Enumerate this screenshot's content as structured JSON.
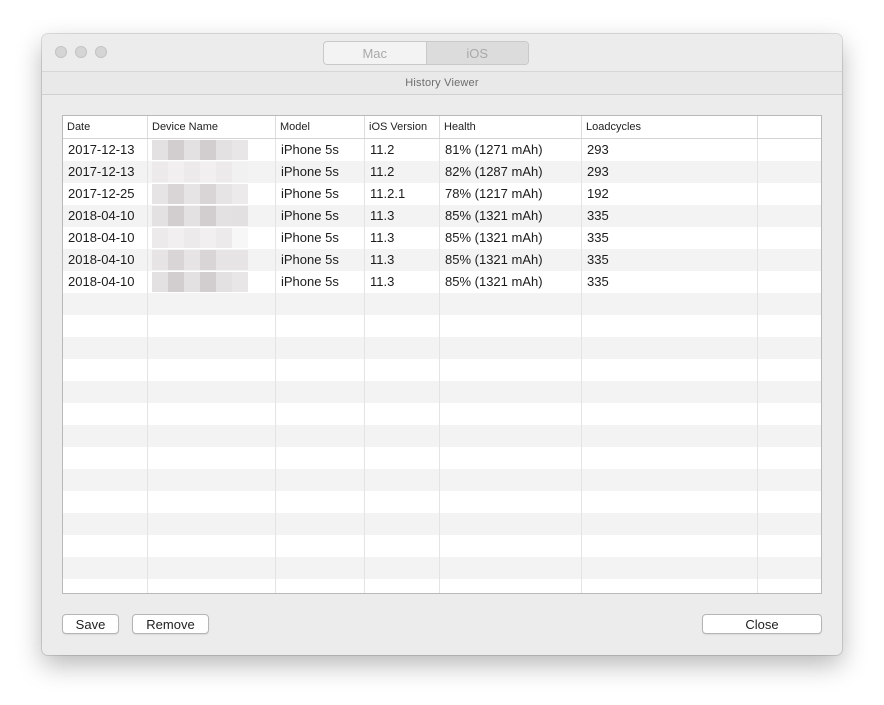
{
  "window": {
    "segmented": [
      "Mac",
      "iOS"
    ],
    "selected_segment": "iOS",
    "subtitle": "History Viewer"
  },
  "table": {
    "columns": [
      "Date",
      "Device Name",
      "Model",
      "iOS Version",
      "Health",
      "Loadcycles",
      ""
    ],
    "rows": [
      {
        "date": "2017-12-13",
        "model": "iPhone 5s",
        "ios": "11.2",
        "health": "81% (1271 mAh)",
        "loadcycles": "293"
      },
      {
        "date": "2017-12-13",
        "model": "iPhone 5s",
        "ios": "11.2",
        "health": "82% (1287 mAh)",
        "loadcycles": "293"
      },
      {
        "date": "2017-12-25",
        "model": "iPhone 5s",
        "ios": "11.2.1",
        "health": "78% (1217 mAh)",
        "loadcycles": "192"
      },
      {
        "date": "2018-04-10",
        "model": "iPhone 5s",
        "ios": "11.3",
        "health": "85% (1321 mAh)",
        "loadcycles": "335"
      },
      {
        "date": "2018-04-10",
        "model": "iPhone 5s",
        "ios": "11.3",
        "health": "85% (1321 mAh)",
        "loadcycles": "335"
      },
      {
        "date": "2018-04-10",
        "model": "iPhone 5s",
        "ios": "11.3",
        "health": "85% (1321 mAh)",
        "loadcycles": "335"
      },
      {
        "date": "2018-04-10",
        "model": "iPhone 5s",
        "ios": "11.3",
        "health": "85% (1321 mAh)",
        "loadcycles": "335"
      }
    ]
  },
  "buttons": {
    "save": "Save",
    "remove": "Remove",
    "close": "Close"
  }
}
